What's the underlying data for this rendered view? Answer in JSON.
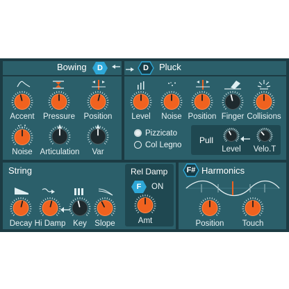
{
  "colors": {
    "panel": "#2b5f6a",
    "frame": "#1c3b43",
    "knob_orange": "#f0621f",
    "knob_dark": "#1e2a2e",
    "badge": "#2ea7d7",
    "badge_dark": "#163c47",
    "ring": "#c9dde0"
  },
  "bowing": {
    "title": "Bowing",
    "badge": "D",
    "knobs": [
      {
        "label": "Accent",
        "icon": "envelope-icon",
        "style": "orange",
        "value": 0.45
      },
      {
        "label": "Pressure",
        "icon": "pressure-icon",
        "style": "orange",
        "value": 0.5
      },
      {
        "label": "Position",
        "icon": "position-icon",
        "style": "orange",
        "value": 0.55
      },
      {
        "label": "Noise",
        "icon": "noise-icon",
        "style": "orange",
        "value": 0.5
      },
      {
        "label": "Articulation",
        "icon": "",
        "style": "dark",
        "value": 0.5
      },
      {
        "label": "Var",
        "icon": "",
        "style": "dark",
        "value": 0.5
      }
    ]
  },
  "link_icon": "double-arrow-icon",
  "pluck": {
    "title": "Pluck",
    "badge": "D",
    "knobs": [
      {
        "label": "Level",
        "icon": "level-bars-icon",
        "style": "orange",
        "value": 0.5
      },
      {
        "label": "Noise",
        "icon": "noise-icon",
        "style": "orange",
        "value": 0.5
      },
      {
        "label": "Position",
        "icon": "position-icon",
        "style": "orange",
        "value": 0.5
      },
      {
        "label": "Finger",
        "icon": "finger-icon",
        "style": "dark",
        "value": 0.45
      },
      {
        "label": "Collisions",
        "icon": "collisions-icon",
        "style": "orange",
        "value": 0.5
      }
    ],
    "mode_options": [
      {
        "label": "Pizzicato",
        "selected": true
      },
      {
        "label": "Col Legno",
        "selected": false
      }
    ],
    "pull": {
      "title": "Pull",
      "knobs": [
        {
          "label": "Level",
          "style": "dark",
          "value": 0.4
        },
        {
          "label": "Velo.T",
          "style": "dark",
          "value": 0.35
        }
      ]
    }
  },
  "string": {
    "title": "String",
    "knobs": [
      {
        "label": "Decay",
        "icon": "decay-ramp-icon",
        "style": "orange",
        "value": 0.55
      },
      {
        "label": "Hi Damp",
        "icon": "hi-damp-icon",
        "style": "orange",
        "value": 0.55
      },
      {
        "label": "Key",
        "icon": "keyboard-icon",
        "style": "dark",
        "value": 0.45
      },
      {
        "label": "Slope",
        "icon": "slope-curve-icon",
        "style": "orange",
        "value": 0.4
      }
    ],
    "rel_damp": {
      "title": "Rel Damp",
      "badge": "F",
      "state": "ON",
      "knob": {
        "label": "Amt",
        "style": "orange",
        "value": 0.5
      }
    }
  },
  "harmonics": {
    "title": "Harmonics",
    "badge": "F#",
    "knobs": [
      {
        "label": "Position",
        "style": "orange",
        "value": 0.5
      },
      {
        "label": "Touch",
        "style": "orange",
        "value": 0.5
      }
    ]
  }
}
